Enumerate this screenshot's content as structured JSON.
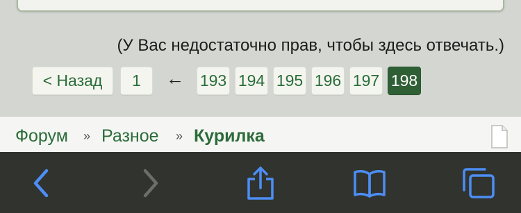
{
  "notice": "(У Вас недостаточно прав, чтобы здесь отвечать.)",
  "pagination": {
    "prev_label": "< Назад",
    "first_page": "1",
    "ellipsis_arrow": "←",
    "pages": [
      "193",
      "194",
      "195",
      "196",
      "197",
      "198"
    ],
    "current_page": "198"
  },
  "breadcrumb": {
    "items": [
      "Форум",
      "Разное",
      "Курилка"
    ],
    "separator": "»"
  },
  "toolbar": {
    "buttons": [
      "back",
      "forward",
      "share",
      "bookmarks",
      "tabs"
    ]
  },
  "colors": {
    "link_green": "#2c6b3a",
    "current_page_bg": "#2f5f34",
    "toolbar_bg": "#30332e",
    "toolbar_accent": "#4d8ef5",
    "toolbar_disabled": "#6b6e6a"
  }
}
